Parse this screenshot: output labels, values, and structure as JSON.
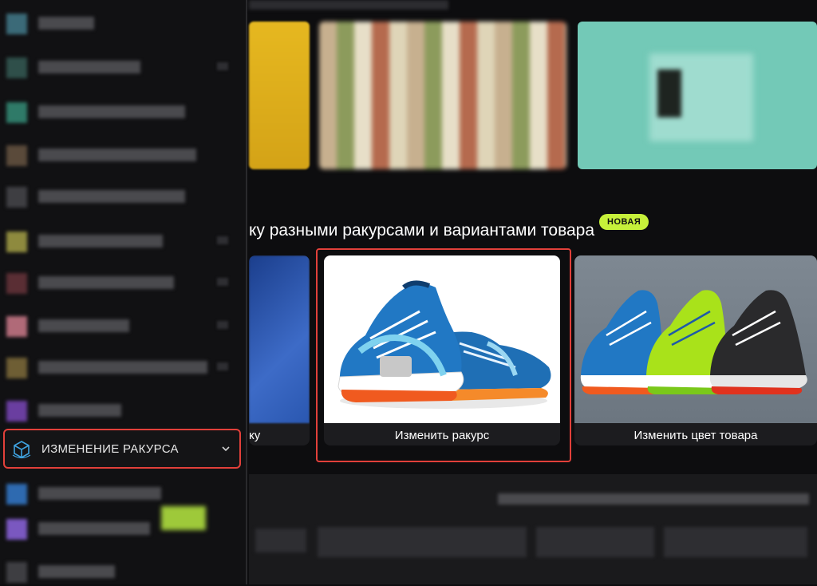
{
  "sidebar": {
    "active_item": {
      "label": "ИЗМЕНЕНИЕ РАКУРСА",
      "icon": "cube-icon",
      "chevron_icon": "chevron-down-icon"
    }
  },
  "main": {
    "section_title": "ку разными ракурсами и вариантами товара",
    "badge": "НОВАЯ",
    "cards": [
      {
        "caption": "ку"
      },
      {
        "caption": "Изменить ракурс"
      },
      {
        "caption": "Изменить цвет товара"
      }
    ]
  },
  "colors": {
    "highlight": "#e2403a",
    "badge": "#c6f03a",
    "background": "#0d0d0f"
  }
}
